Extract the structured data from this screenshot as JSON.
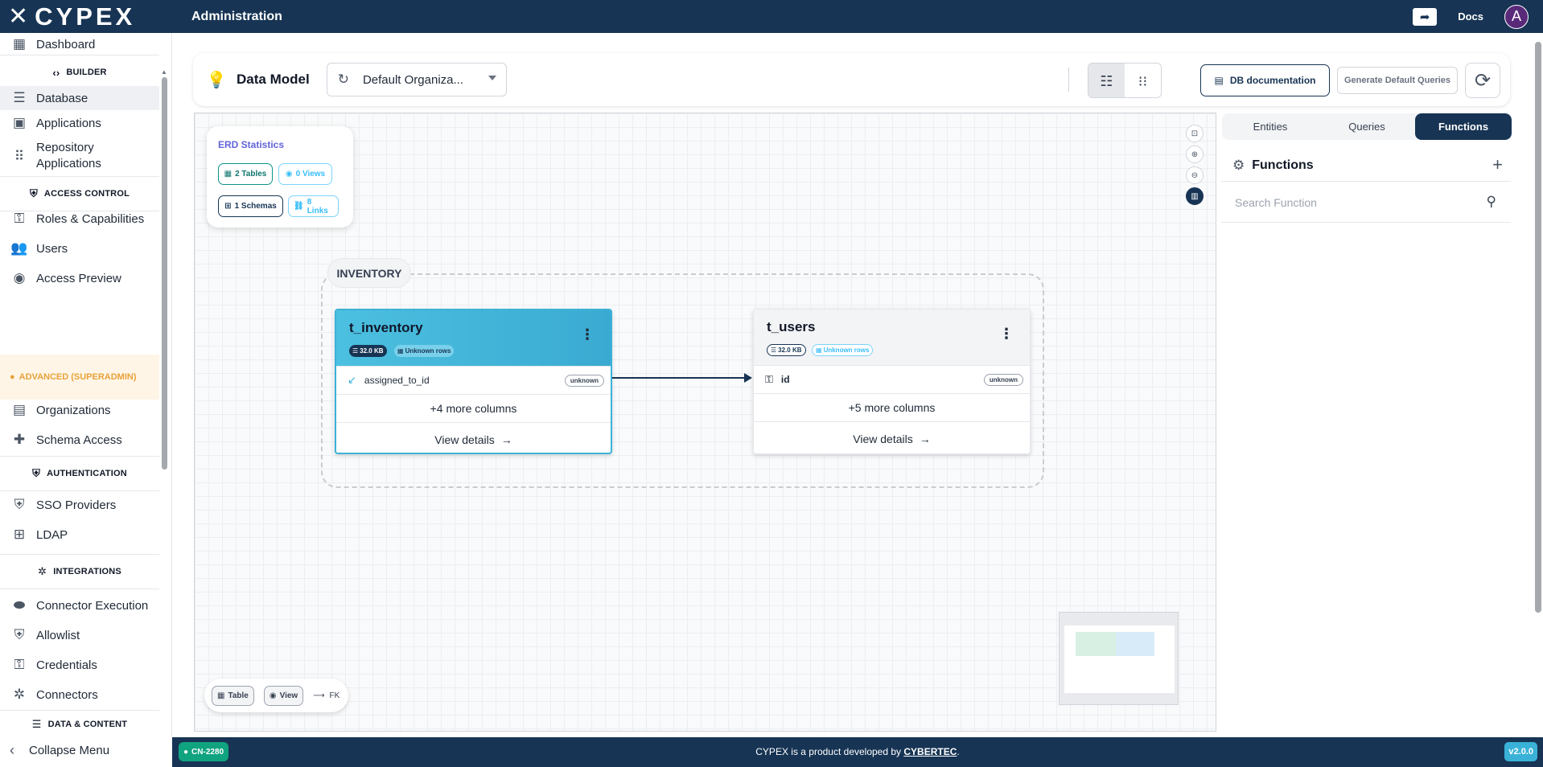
{
  "app": {
    "logo_text": "CYPEX",
    "section_title": "Administration",
    "docs_label": "Docs",
    "avatar_initial": "A"
  },
  "sidebar": {
    "items": [
      {
        "label": "Dashboard",
        "icon": "dashboard-icon"
      },
      {
        "label": "Database",
        "icon": "database-icon"
      },
      {
        "label": "Applications",
        "icon": "applications-icon"
      },
      {
        "label": "Repository Applications",
        "icon": "grid-icon"
      },
      {
        "label": "Roles & Capabilities",
        "icon": "key-icon"
      },
      {
        "label": "Users",
        "icon": "users-icon"
      },
      {
        "label": "Access Preview",
        "icon": "eye-icon"
      },
      {
        "label": "Organizations",
        "icon": "organizations-icon"
      },
      {
        "label": "Schema Access",
        "icon": "puzzle-icon"
      },
      {
        "label": "SSO Providers",
        "icon": "shield-icon"
      },
      {
        "label": "LDAP",
        "icon": "ldap-icon"
      },
      {
        "label": "Connector Execution",
        "icon": "toggle-icon"
      },
      {
        "label": "Allowlist",
        "icon": "shield-icon"
      },
      {
        "label": "Credentials",
        "icon": "key-icon"
      },
      {
        "label": "Connectors",
        "icon": "hub-icon"
      }
    ],
    "headers": {
      "builder": "BUILDER",
      "access_control": "ACCESS CONTROL",
      "advanced": "ADVANCED (SUPERADMIN)",
      "authentication": "AUTHENTICATION",
      "integrations": "INTEGRATIONS",
      "data_content": "DATA & CONTENT"
    },
    "collapse_label": "Collapse Menu"
  },
  "header": {
    "title": "Data Model",
    "org_select_value": "Default Organiza...",
    "db_doc_label": "DB documentation",
    "gen_queries_label": "Generate Default Queries"
  },
  "erd_stats": {
    "title": "ERD Statistics",
    "tables": "2 Tables",
    "views": "0 Views",
    "schemas": "1 Schemas",
    "links": "8 Links"
  },
  "group": {
    "label": "INVENTORY"
  },
  "tables": [
    {
      "name": "t_inventory",
      "size": "32.0 KB",
      "rows": "Unknown rows",
      "column": "assigned_to_id",
      "column_type": "unknown",
      "more": "+4 more columns",
      "view": "View details"
    },
    {
      "name": "t_users",
      "size": "32.0 KB",
      "rows": "Unknown rows",
      "column": "id",
      "column_type": "unknown",
      "more": "+5 more columns",
      "view": "View details"
    }
  ],
  "legend": {
    "table": "Table",
    "view": "View",
    "fk": "FK"
  },
  "right_panel": {
    "tabs": [
      "Entities",
      "Queries",
      "Functions"
    ],
    "active_tab": "Functions",
    "title": "Functions",
    "search_placeholder": "Search Function"
  },
  "footer": {
    "ticket": "CN-2280",
    "text_prefix": "CYPEX is a product developed by ",
    "brand": "CYBERTEC",
    "text_suffix": ".",
    "version": "v2.0.0"
  },
  "colors": {
    "primary": "#173454",
    "accent": "#3ab2d8",
    "teal": "#0d9488",
    "advanced": "#e8a23a"
  }
}
